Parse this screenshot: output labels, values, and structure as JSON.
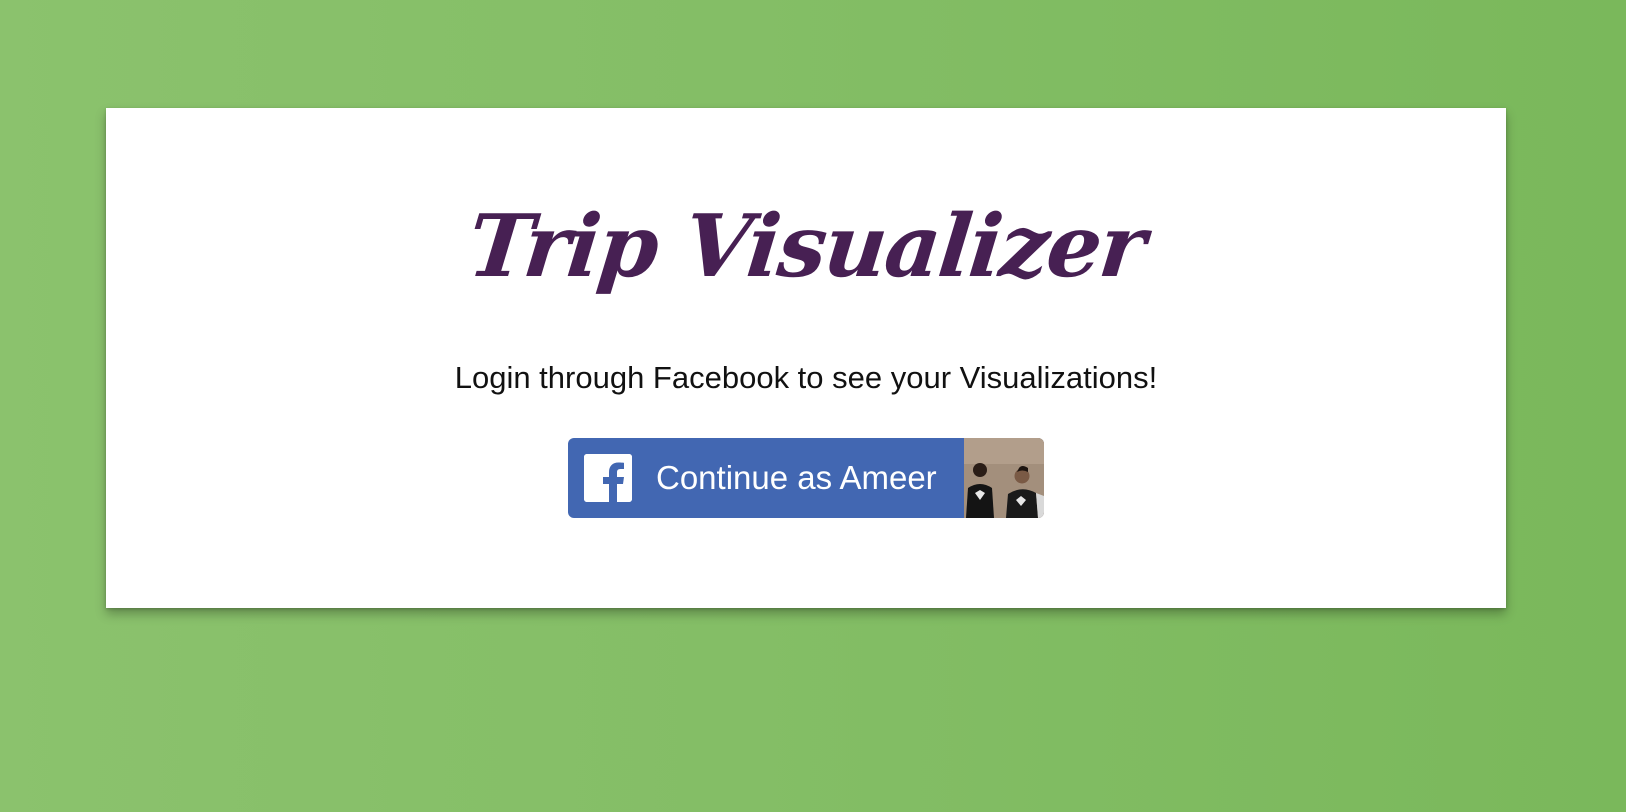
{
  "app": {
    "title": "Trip Visualizer",
    "subtitle": "Login through Facebook to see your Visualizations!"
  },
  "login": {
    "button_label": "Continue as Ameer",
    "logo_icon": "facebook-f-icon",
    "avatar_icon": "profile-photo"
  },
  "colors": {
    "background": "#84be66",
    "card": "#ffffff",
    "title": "#472053",
    "facebook_blue": "#4267b2"
  }
}
